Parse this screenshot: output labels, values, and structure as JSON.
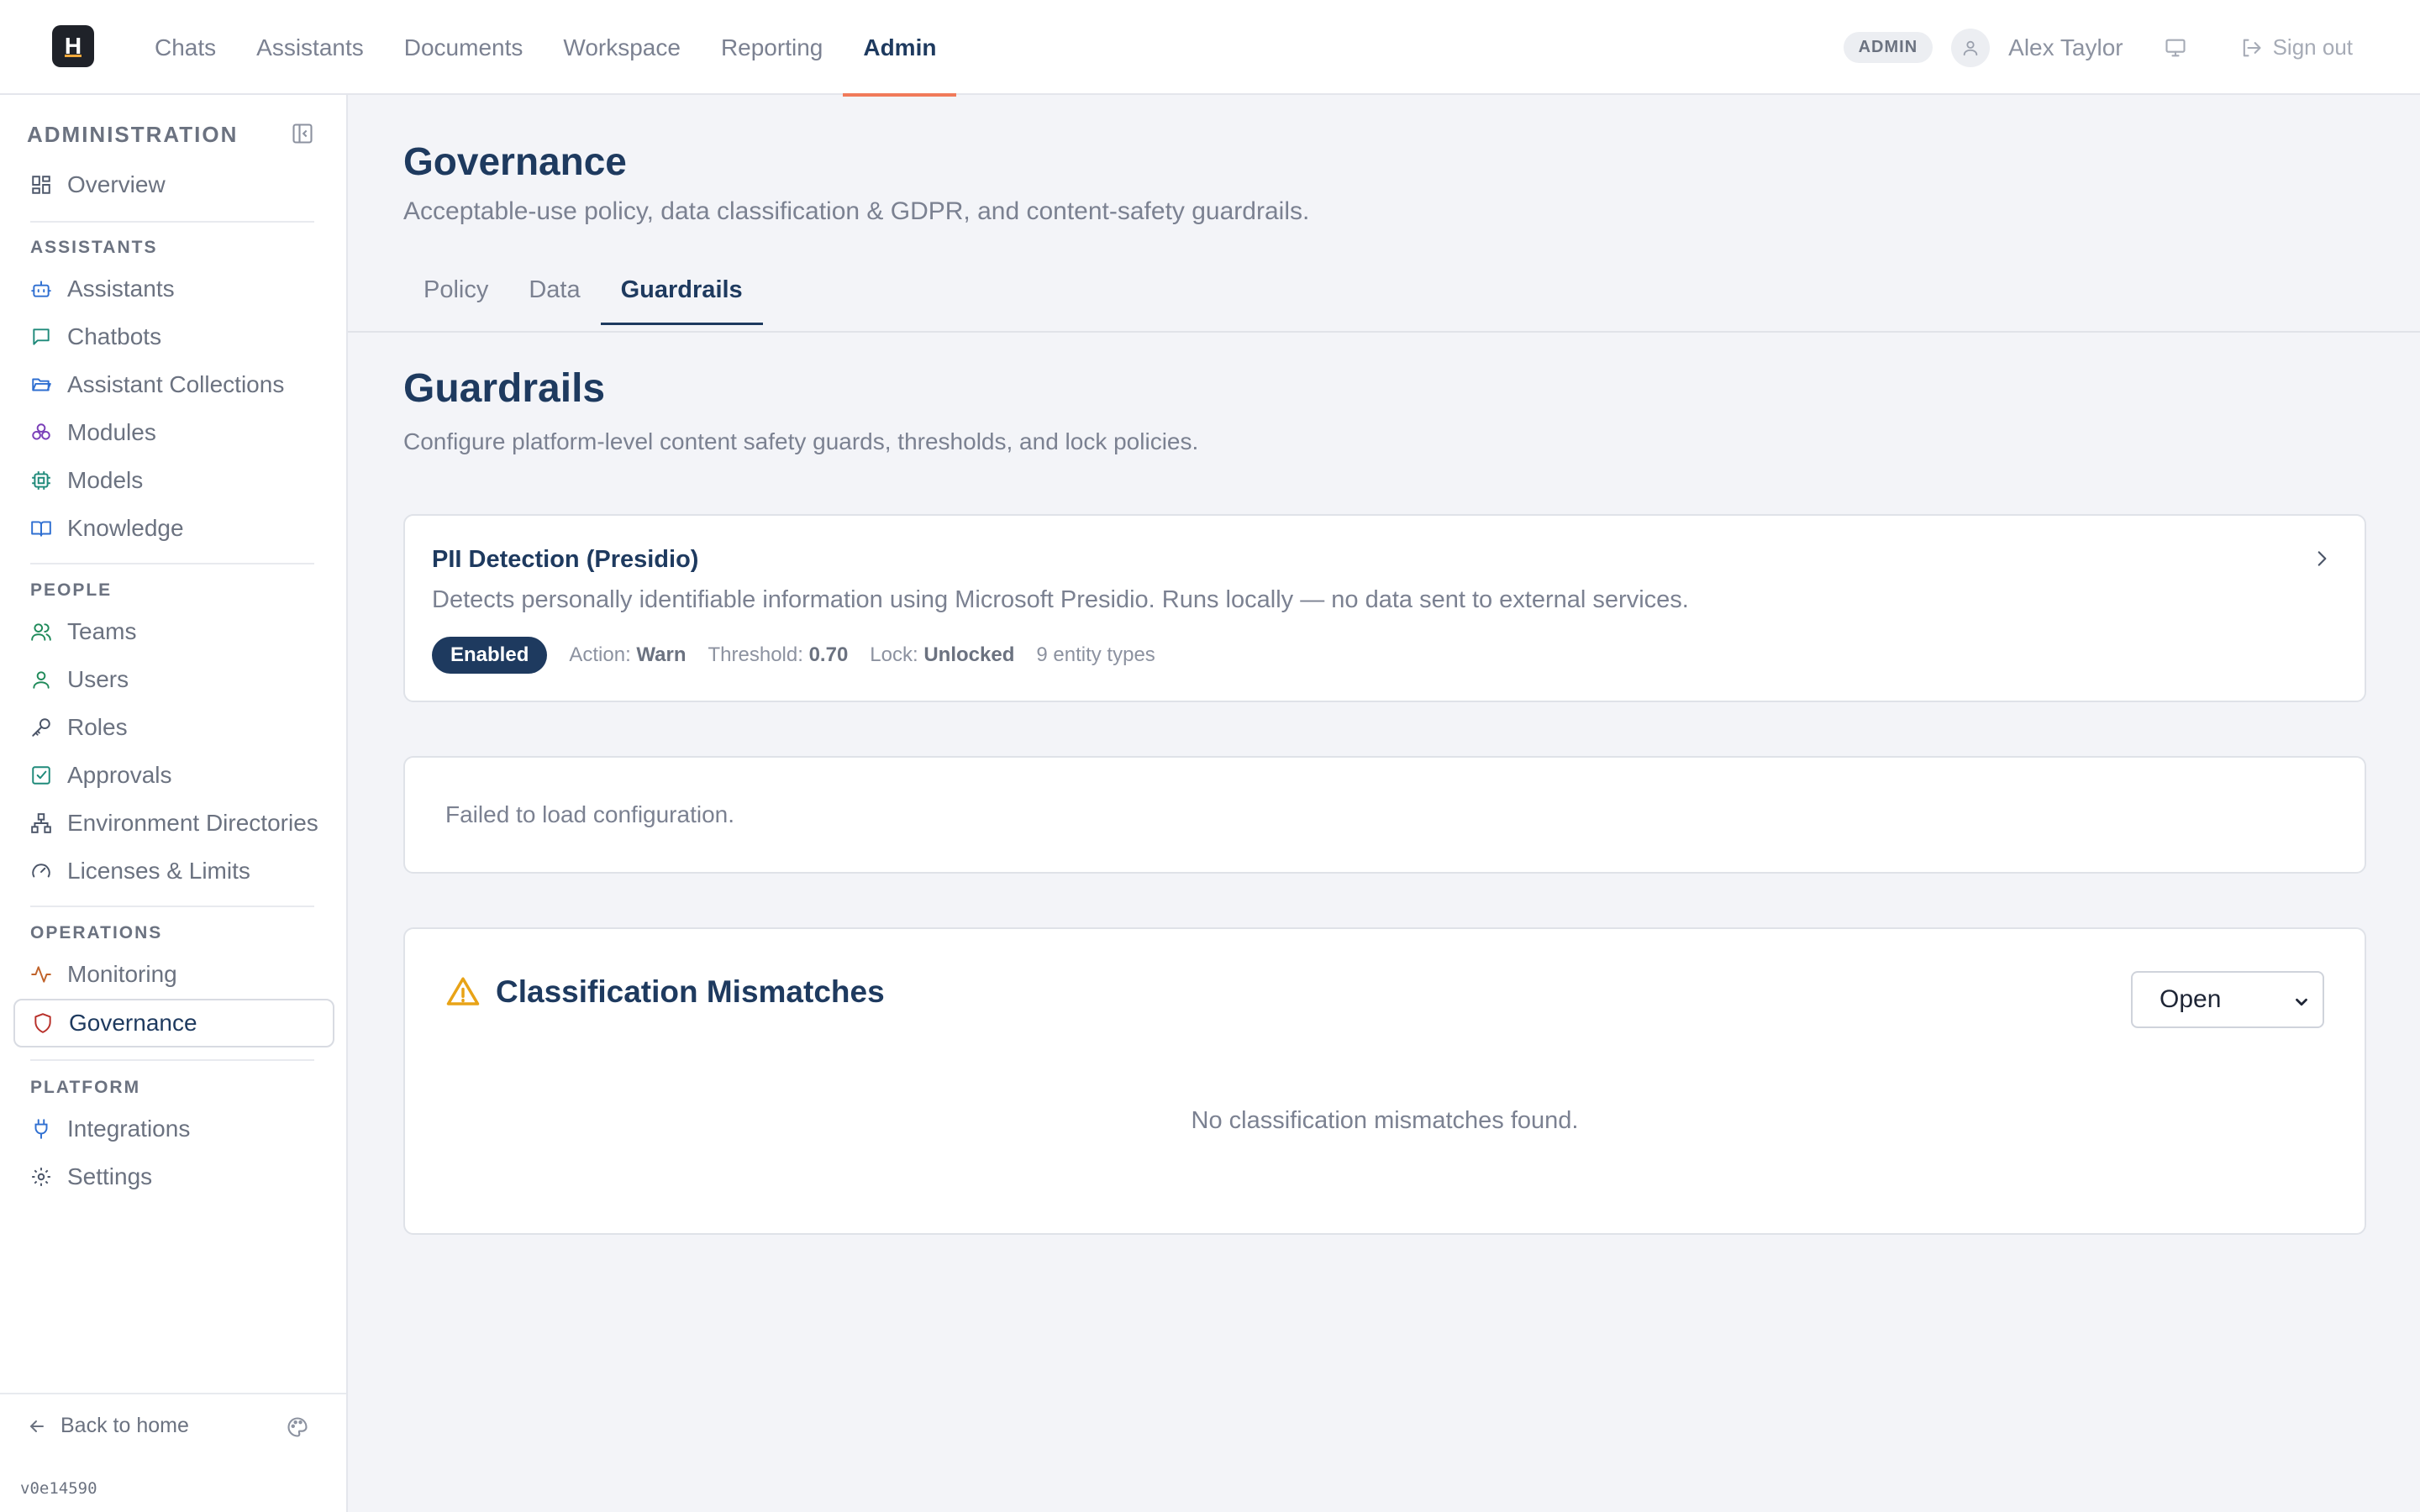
{
  "app": {
    "logo_letter": "H"
  },
  "nav": {
    "items": [
      {
        "label": "Chats"
      },
      {
        "label": "Assistants"
      },
      {
        "label": "Documents"
      },
      {
        "label": "Workspace"
      },
      {
        "label": "Reporting"
      },
      {
        "label": "Admin"
      }
    ],
    "active": "Admin"
  },
  "user": {
    "role_badge": "ADMIN",
    "name": "Alex Taylor",
    "sign_out": "Sign out"
  },
  "sidebar": {
    "title": "ADMINISTRATION",
    "overview": "Overview",
    "sections": {
      "assistants": "ASSISTANTS",
      "people": "PEOPLE",
      "operations": "OPERATIONS",
      "platform": "PLATFORM"
    },
    "items": {
      "assistants": "Assistants",
      "chatbots": "Chatbots",
      "assistant_collections": "Assistant Collections",
      "modules": "Modules",
      "models": "Models",
      "knowledge": "Knowledge",
      "teams": "Teams",
      "users": "Users",
      "roles": "Roles",
      "approvals": "Approvals",
      "environment_directories": "Environment Directories",
      "licenses": "Licenses & Limits",
      "monitoring": "Monitoring",
      "governance": "Governance",
      "integrations": "Integrations",
      "settings": "Settings"
    },
    "back_home": "Back to home",
    "version": "v0e14590"
  },
  "page": {
    "title": "Governance",
    "subtitle": "Acceptable-use policy, data classification & GDPR, and content-safety guardrails.",
    "tabs": [
      "Policy",
      "Data",
      "Guardrails"
    ],
    "active_tab": "Guardrails"
  },
  "guardrails": {
    "title": "Guardrails",
    "subtitle": "Configure platform-level content safety guards, thresholds, and lock policies.",
    "pii": {
      "title": "PII Detection (Presidio)",
      "description": "Detects personally identifiable information using Microsoft Presidio. Runs locally — no data sent to external services.",
      "status": "Enabled",
      "action_label": "Action:",
      "action_value": "Warn",
      "threshold_label": "Threshold:",
      "threshold_value": "0.70",
      "lock_label": "Lock:",
      "lock_value": "Unlocked",
      "entity_types": "9 entity types"
    },
    "error_message": "Failed to load configuration.",
    "mismatches": {
      "title": "Classification Mismatches",
      "filter_value": "Open",
      "empty": "No classification mismatches found."
    }
  },
  "colors": {
    "primary": "#1e3a5f",
    "accent": "#f07a5a",
    "warning": "#e8a317",
    "background": "#f3f4f8"
  }
}
